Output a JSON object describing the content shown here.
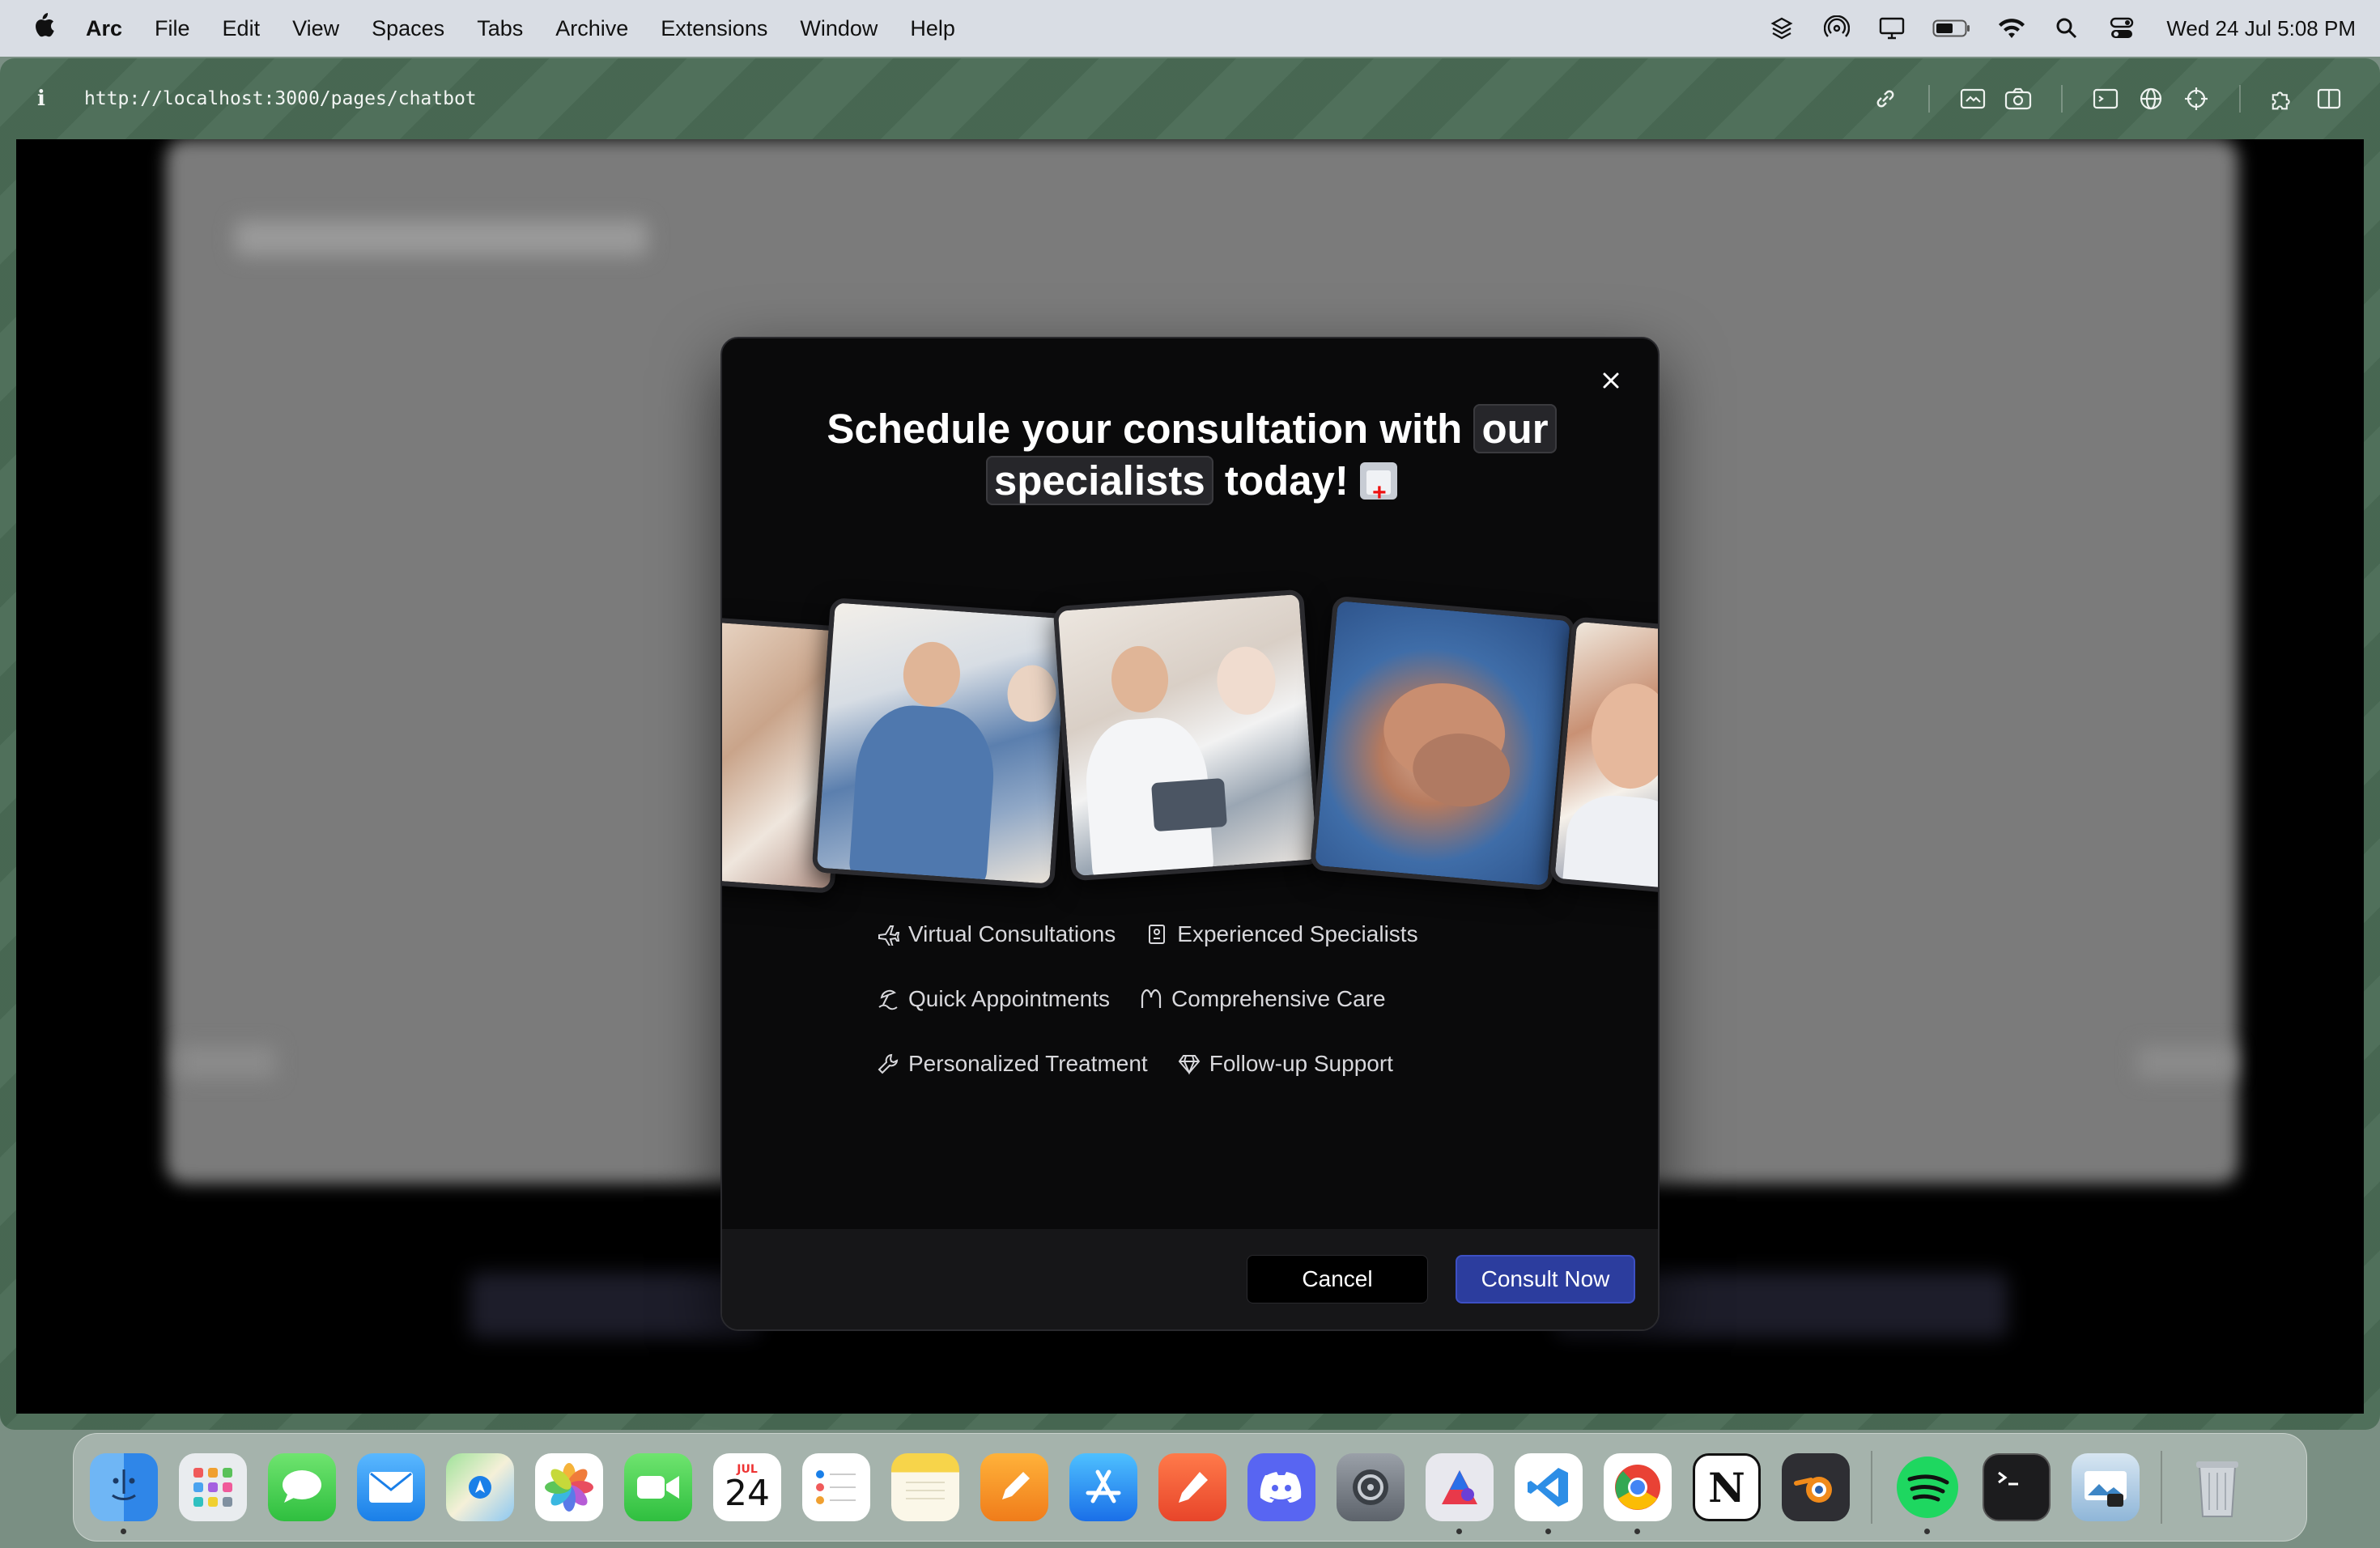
{
  "menubar": {
    "app_name": "Arc",
    "items": [
      "File",
      "Edit",
      "View",
      "Spaces",
      "Tabs",
      "Archive",
      "Extensions",
      "Window",
      "Help"
    ],
    "status_icons": [
      "layers-icon",
      "airdrop-icon",
      "display-icon",
      "battery-icon",
      "wifi-icon",
      "search-icon",
      "control-center-icon"
    ],
    "clock": "Wed 24 Jul  5:08 PM"
  },
  "browser": {
    "url": "http://localhost:3000/pages/chatbot",
    "toolbar_icons": [
      "link-icon",
      "capture-icon",
      "camera-icon",
      "console-icon",
      "globe-icon",
      "crosshair-icon",
      "extensions-icon",
      "split-view-icon"
    ]
  },
  "modal": {
    "title_pre": "Schedule your consultation with ",
    "title_hl1": "our",
    "title_hl2": "specialists",
    "title_post": " today!",
    "features": [
      [
        "Virtual Consultations",
        "Experienced Specialists"
      ],
      [
        "Quick Appointments",
        "Comprehensive Care"
      ],
      [
        "Personalized Treatment",
        "Follow-up Support"
      ]
    ],
    "cancel_label": "Cancel",
    "primary_label": "Consult Now"
  },
  "dock": {
    "calendar_month": "JUL",
    "calendar_day": "24",
    "apps": [
      "Finder",
      "Launchpad",
      "Messages",
      "Mail",
      "Maps",
      "Photos",
      "FaceTime",
      "Calendar",
      "Reminders",
      "Notes",
      "Pages",
      "App Store",
      "Pen",
      "Discord",
      "System Settings",
      "Affinity",
      "VS Code",
      "Chrome",
      "Notion",
      "Blender",
      "Spotify",
      "Terminal",
      "Preview",
      "Trash"
    ]
  }
}
